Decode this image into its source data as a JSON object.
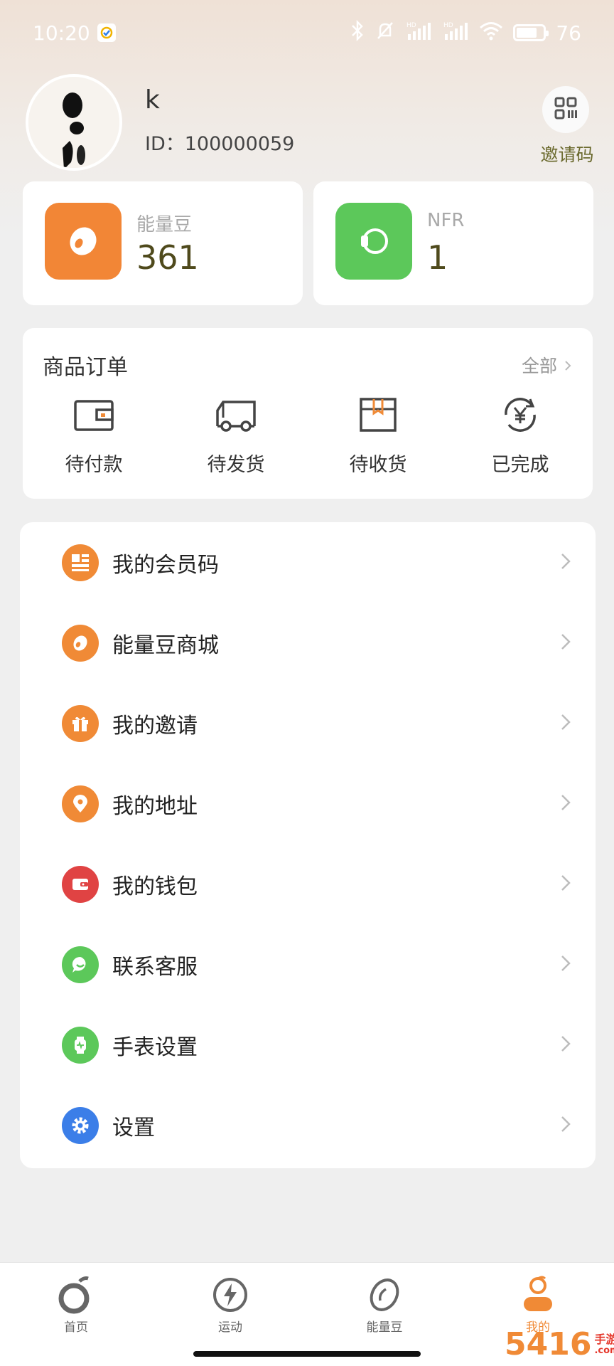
{
  "status_bar": {
    "time": "10:20",
    "battery": "76"
  },
  "profile": {
    "username": "k",
    "user_id": "ID：100000059",
    "invite_label": "邀请码"
  },
  "stats": {
    "energy_beans": {
      "label": "能量豆",
      "value": "361",
      "color": "#f28636"
    },
    "nfr": {
      "label": "NFR",
      "value": "1",
      "color": "#5cc85a"
    }
  },
  "orders": {
    "title": "商品订单",
    "all_label": "全部",
    "items": [
      {
        "label": "待付款",
        "icon": "wallet-icon"
      },
      {
        "label": "待发货",
        "icon": "truck-icon"
      },
      {
        "label": "待收货",
        "icon": "package-icon"
      },
      {
        "label": "已完成",
        "icon": "yen-refresh-icon"
      }
    ]
  },
  "menu": [
    {
      "label": "我的会员码",
      "icon": "member-code-icon",
      "color": "#f08a36"
    },
    {
      "label": "能量豆商城",
      "icon": "bean-icon",
      "color": "#f08a36"
    },
    {
      "label": "我的邀请",
      "icon": "gift-icon",
      "color": "#f08a36"
    },
    {
      "label": "我的地址",
      "icon": "location-pin-icon",
      "color": "#f08a36"
    },
    {
      "label": "我的钱包",
      "icon": "wallet-icon",
      "color": "#e04343"
    },
    {
      "label": "联系客服",
      "icon": "chat-icon",
      "color": "#5cc85a"
    },
    {
      "label": "手表设置",
      "icon": "watch-icon",
      "color": "#5cc85a"
    },
    {
      "label": "设置",
      "icon": "gear-icon",
      "color": "#3b7ee8"
    }
  ],
  "bottom_nav": [
    {
      "label": "首页",
      "icon": "home-icon"
    },
    {
      "label": "运动",
      "icon": "lightning-icon"
    },
    {
      "label": "能量豆",
      "icon": "bean-icon"
    },
    {
      "label": "我的",
      "icon": "profile-icon",
      "active": true
    }
  ],
  "watermark": {
    "big": "5416",
    "small_top": "手游网",
    "small_bottom": ".com.cn"
  }
}
